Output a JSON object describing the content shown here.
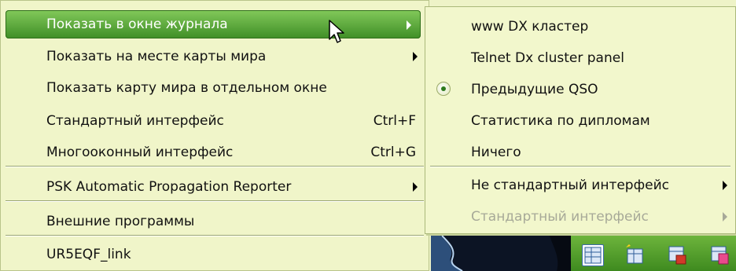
{
  "main_menu": {
    "items": [
      {
        "label": "Показать в окне журнала"
      },
      {
        "label": "Показать на месте карты мира"
      },
      {
        "label": "Показать карту мира в отдельном окне"
      },
      {
        "label": "Стандартный интерфейс",
        "shortcut": "Ctrl+F"
      },
      {
        "label": "Многооконный интерфейс",
        "shortcut": "Ctrl+G"
      },
      {
        "label": "PSK Automatic Propagation Reporter"
      },
      {
        "label": "Внешние программы"
      },
      {
        "label": "UR5EQF_link"
      }
    ]
  },
  "submenu": {
    "items": [
      {
        "label": "www DX кластер"
      },
      {
        "label": "Telnet Dx cluster panel"
      },
      {
        "label": "Предыдущие QSO",
        "selected": true
      },
      {
        "label": "Статистика по дипломам"
      },
      {
        "label": "Ничего"
      },
      {
        "label": "Не стандартный интерфейс"
      },
      {
        "label": "Стандартный интерфейс",
        "disabled": true
      }
    ]
  },
  "colors": {
    "highlight": "#4f9e2f",
    "menu_bg": "#f0f5c9",
    "toolbar": "#55a12e",
    "disabled_text": "#a7a998"
  },
  "toolbar_icons": [
    "log-table-icon",
    "new-table-icon",
    "save-table-icon",
    "chart-table-icon"
  ]
}
